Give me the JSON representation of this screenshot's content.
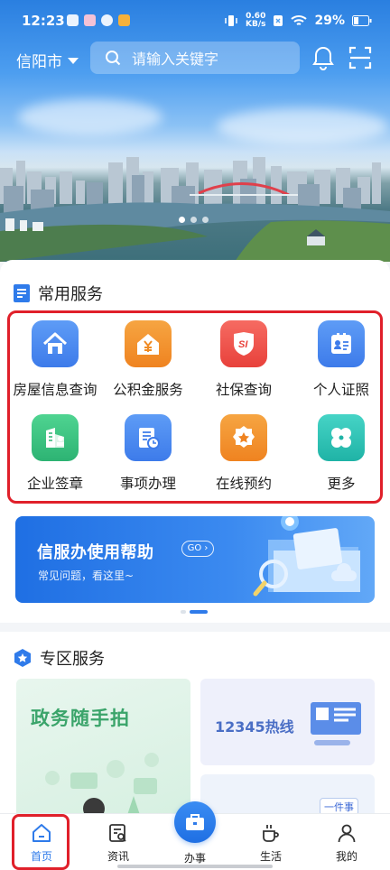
{
  "status_bar": {
    "time": "12:23",
    "netspeed_value": "0.60",
    "netspeed_unit": "KB/s",
    "battery": "29%"
  },
  "header": {
    "city": "信阳市",
    "search_placeholder": "请输入关键字"
  },
  "common_services": {
    "title": "常用服务",
    "items": [
      {
        "label": "房屋信息查询",
        "icon": "house-icon",
        "color": "#3d7bea"
      },
      {
        "label": "公积金服务",
        "icon": "yuan-house-icon",
        "color": "#f08b24"
      },
      {
        "label": "社保查询",
        "icon": "social-security-shield-icon",
        "color": "#ee4a43"
      },
      {
        "label": "个人证照",
        "icon": "id-card-icon",
        "color": "#3d7bea"
      },
      {
        "label": "企业签章",
        "icon": "enterprise-seal-icon",
        "color": "#36c07d"
      },
      {
        "label": "事项办理",
        "icon": "document-clock-icon",
        "color": "#3d7bea"
      },
      {
        "label": "在线预约",
        "icon": "star-badge-icon",
        "color": "#f08b24"
      },
      {
        "label": "更多",
        "icon": "four-petal-more-icon",
        "color": "#29c0b3"
      }
    ]
  },
  "help_banner": {
    "title": "信服办使用帮助",
    "go": "GO",
    "subtitle": "常见问题，看这里~"
  },
  "zone_services": {
    "title": "专区服务",
    "cards": [
      {
        "label": "政务随手拍"
      },
      {
        "label": "12345热线"
      },
      {
        "label": "一件事"
      }
    ]
  },
  "bottom_nav": [
    {
      "label": "首页",
      "icon": "home-icon",
      "active": true
    },
    {
      "label": "资讯",
      "icon": "news-search-icon"
    },
    {
      "label": "办事",
      "icon": "briefcase-icon"
    },
    {
      "label": "生活",
      "icon": "coffee-cup-icon"
    },
    {
      "label": "我的",
      "icon": "user-icon"
    }
  ]
}
